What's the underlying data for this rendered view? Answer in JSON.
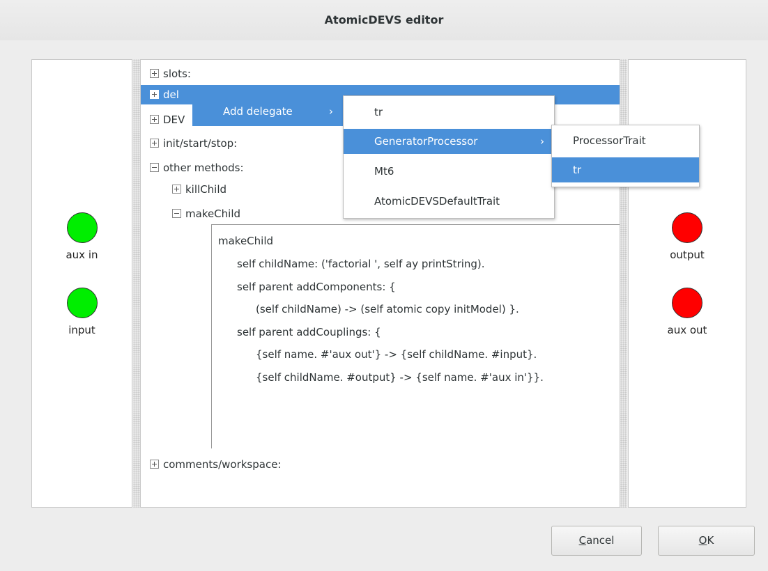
{
  "window": {
    "title": "AtomicDEVS editor"
  },
  "inputs": [
    {
      "label": "aux in",
      "color": "#00ee00"
    },
    {
      "label": "input",
      "color": "#00ee00"
    }
  ],
  "outputs": [
    {
      "label": "output",
      "color": "#ff0000"
    },
    {
      "label": "aux out",
      "color": "#ff0000"
    }
  ],
  "tree": {
    "slots": "slots:",
    "delegates_visible": "del",
    "devs_visible": "DEV",
    "init": "init/start/stop:",
    "other_methods": "other methods:",
    "kill_child": "killChild",
    "make_child": "makeChild",
    "comments": "comments/workspace:"
  },
  "code": {
    "lines": [
      "makeChild",
      "self childName: ('factorial ', self ay printString).",
      "self parent addComponents: {",
      "(self childName) -> (self atomic copy initModel) }.",
      "self parent addCouplings: {",
      "{self name. #'aux out'} -> {self childName. #input}.",
      "{self childName. #output} -> {self name. #'aux in'}}."
    ]
  },
  "menus": {
    "level1": [
      {
        "label": "Add delegate",
        "submenu_arrow": "›"
      }
    ],
    "level2": [
      {
        "label": "tr"
      },
      {
        "label": "GeneratorProcessor",
        "submenu_arrow": "›"
      },
      {
        "label": "Mt6"
      },
      {
        "label": "AtomicDEVSDefaultTrait"
      }
    ],
    "level3": [
      {
        "label": "ProcessorTrait"
      },
      {
        "label": "tr"
      }
    ]
  },
  "buttons": {
    "cancel_mnemonic": "C",
    "cancel_rest": "ancel",
    "ok_mnemonic": "O",
    "ok_rest": "K"
  },
  "colors": {
    "selection": "#4a90d9",
    "input_port": "#00ee00",
    "output_port": "#ff0000"
  }
}
